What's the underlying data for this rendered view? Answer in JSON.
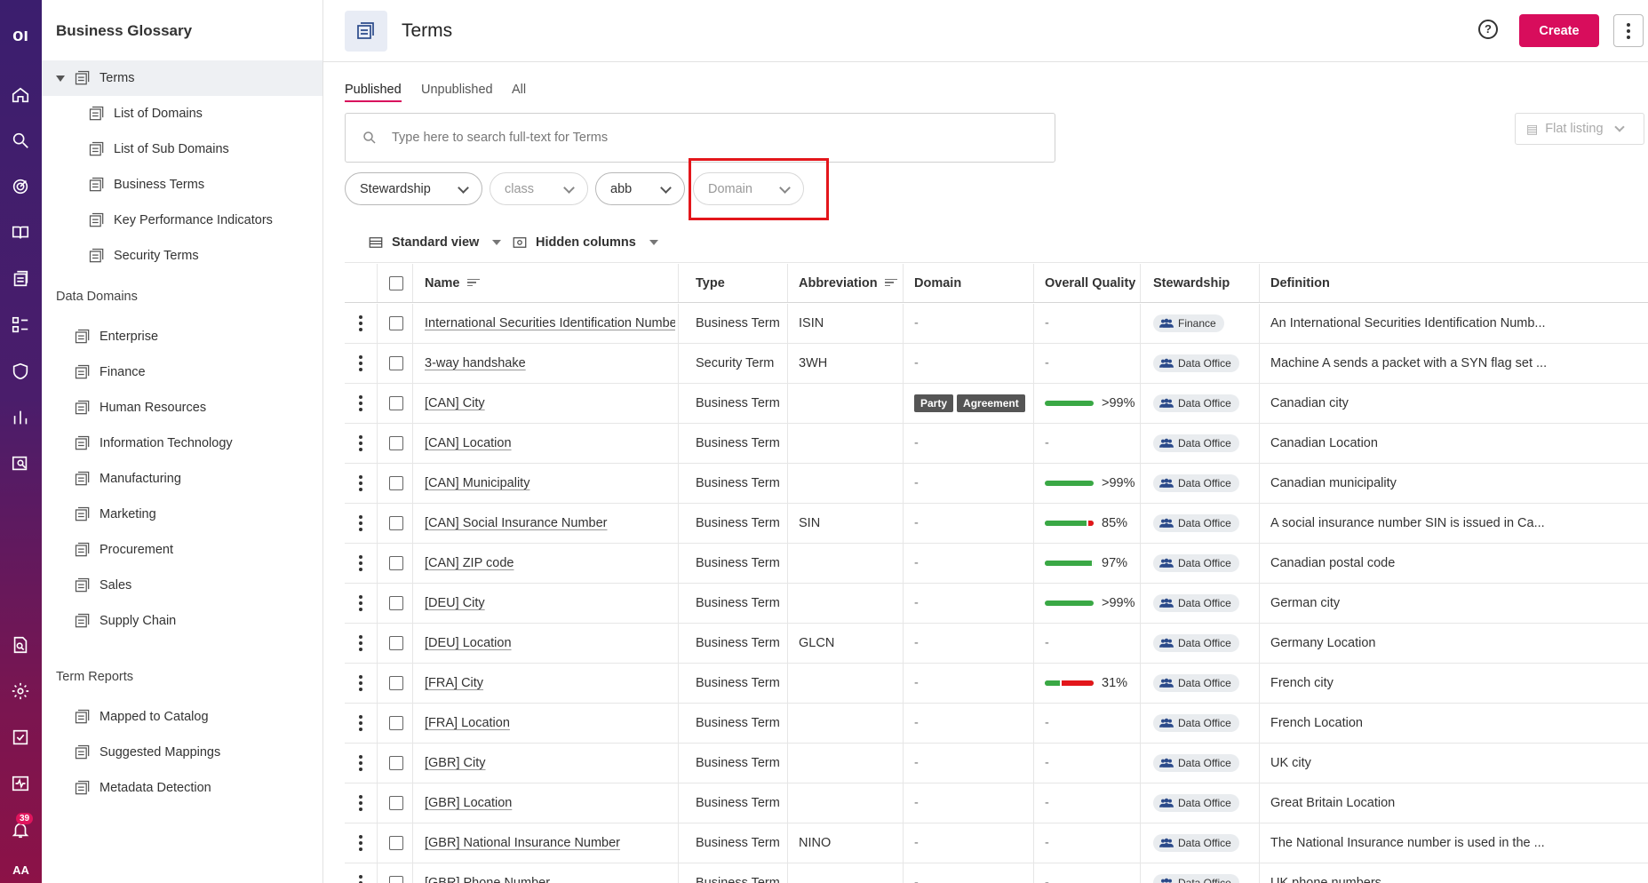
{
  "rail": {
    "notification_count": "39",
    "user_initials": "AA"
  },
  "sidebar": {
    "title": "Business Glossary",
    "root_item": "Terms",
    "term_items": [
      "List of Domains",
      "List of Sub Domains",
      "Business Terms",
      "Key Performance Indicators",
      "Security Terms"
    ],
    "data_domains_title": "Data Domains",
    "data_domains": [
      "Enterprise",
      "Finance",
      "Human Resources",
      "Information Technology",
      "Manufacturing",
      "Marketing",
      "Procurement",
      "Sales",
      "Supply Chain"
    ],
    "term_reports_title": "Term Reports",
    "term_reports": [
      "Mapped to Catalog",
      "Suggested Mappings",
      "Metadata Detection"
    ]
  },
  "header": {
    "title": "Terms",
    "create_label": "Create"
  },
  "tabs": [
    "Published",
    "Unpublished",
    "All"
  ],
  "search": {
    "placeholder": "Type here to search full-text for Terms"
  },
  "flat_listing": "Flat listing",
  "filters": {
    "stewardship": "Stewardship",
    "class": "class",
    "abb": "abb",
    "domain": "Domain"
  },
  "viewbar": {
    "view_label": "Standard view",
    "hidden_label": "Hidden columns"
  },
  "columns": {
    "name": "Name",
    "type": "Type",
    "abbreviation": "Abbreviation",
    "domain": "Domain",
    "quality": "Overall Quality",
    "stewardship": "Stewardship",
    "definition": "Definition"
  },
  "colors": {
    "accent": "#d80d5c",
    "quality_good": "#3aa845",
    "quality_bad": "#e3161b",
    "highlight": "#e3161b"
  },
  "rows": [
    {
      "name": "International Securities Identification Number",
      "type": "Business Term",
      "abbreviation": "ISIN",
      "domain": "-",
      "quality": "-",
      "steward": "Finance",
      "definition": "An International Securities Identification Numb..."
    },
    {
      "name": "3-way handshake",
      "type": "Security Term",
      "abbreviation": "3WH",
      "domain": "-",
      "quality": "-",
      "steward": "Data Office",
      "definition": "Machine A sends a packet with a SYN flag set ..."
    },
    {
      "name": "[CAN] City",
      "type": "Business Term",
      "abbreviation": "",
      "domain_tags": [
        "Party",
        "Agreement"
      ],
      "quality": ">99%",
      "quality_fraction": 0.995,
      "steward": "Data Office",
      "definition": "Canadian city"
    },
    {
      "name": "[CAN] Location",
      "type": "Business Term",
      "abbreviation": "",
      "domain": "-",
      "quality": "-",
      "steward": "Data Office",
      "definition": "Canadian Location"
    },
    {
      "name": "[CAN] Municipality",
      "type": "Business Term",
      "abbreviation": "",
      "domain": "-",
      "quality": ">99%",
      "quality_fraction": 0.995,
      "steward": "Data Office",
      "definition": "Canadian municipality"
    },
    {
      "name": "[CAN] Social Insurance Number",
      "type": "Business Term",
      "abbreviation": "SIN",
      "domain": "-",
      "quality": "85%",
      "quality_fraction": 0.85,
      "steward": "Data Office",
      "definition": "A social insurance number SIN is issued in Ca..."
    },
    {
      "name": "[CAN] ZIP code",
      "type": "Business Term",
      "abbreviation": "",
      "domain": "-",
      "quality": "97%",
      "quality_fraction": 0.97,
      "steward": "Data Office",
      "definition": "Canadian postal code"
    },
    {
      "name": "[DEU] City",
      "type": "Business Term",
      "abbreviation": "",
      "domain": "-",
      "quality": ">99%",
      "quality_fraction": 0.995,
      "steward": "Data Office",
      "definition": "German city"
    },
    {
      "name": "[DEU] Location",
      "type": "Business Term",
      "abbreviation": "GLCN",
      "domain": "-",
      "quality": "-",
      "steward": "Data Office",
      "definition": "Germany Location"
    },
    {
      "name": "[FRA] City",
      "type": "Business Term",
      "abbreviation": "",
      "domain": "-",
      "quality": "31%",
      "quality_fraction": 0.31,
      "steward": "Data Office",
      "definition": "French city"
    },
    {
      "name": "[FRA] Location",
      "type": "Business Term",
      "abbreviation": "",
      "domain": "-",
      "quality": "-",
      "steward": "Data Office",
      "definition": "French Location"
    },
    {
      "name": "[GBR] City",
      "type": "Business Term",
      "abbreviation": "",
      "domain": "-",
      "quality": "-",
      "steward": "Data Office",
      "definition": "UK city"
    },
    {
      "name": "[GBR] Location",
      "type": "Business Term",
      "abbreviation": "",
      "domain": "-",
      "quality": "-",
      "steward": "Data Office",
      "definition": "Great Britain Location"
    },
    {
      "name": "[GBR] National Insurance Number",
      "type": "Business Term",
      "abbreviation": "NINO",
      "domain": "-",
      "quality": "-",
      "steward": "Data Office",
      "definition": "The National Insurance number is used in the ..."
    },
    {
      "name": "[GBR] Phone Number",
      "type": "Business Term",
      "abbreviation": "",
      "domain": "-",
      "quality": "-",
      "steward": "Data Office",
      "definition": "UK phone numbers"
    }
  ]
}
